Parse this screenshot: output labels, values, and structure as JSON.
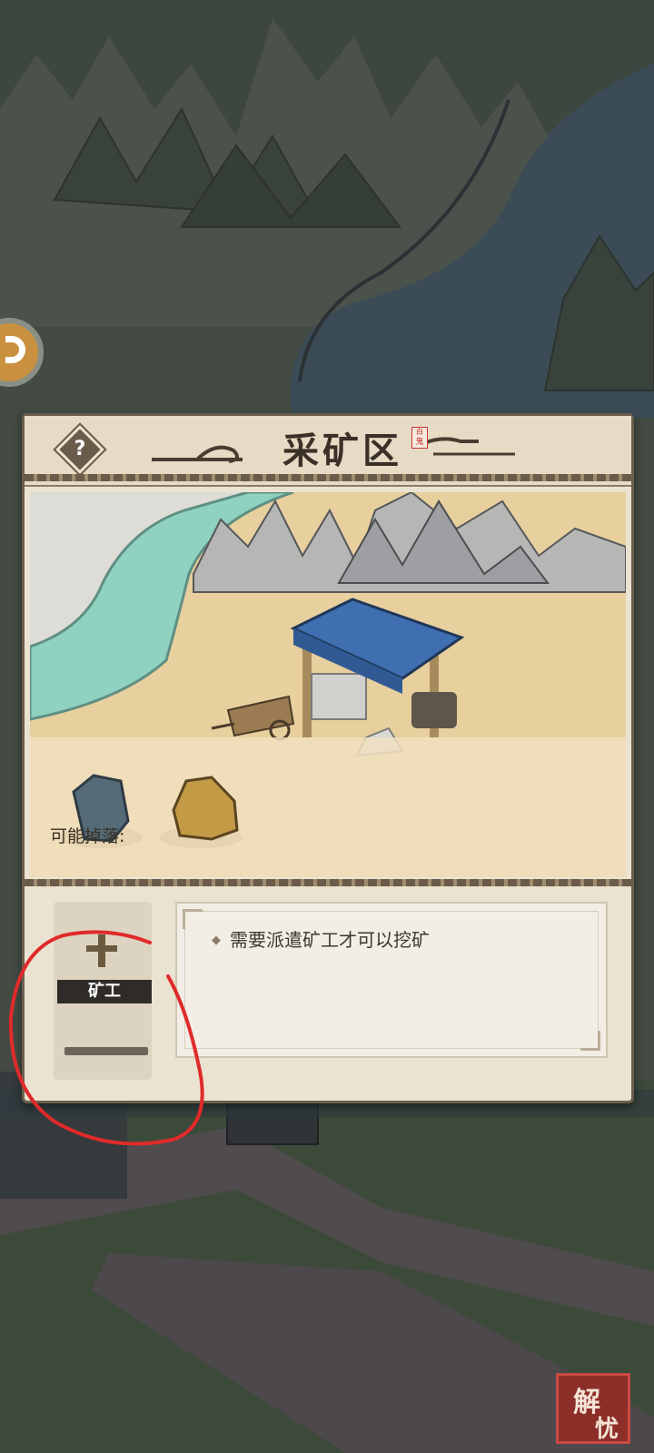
{
  "panel": {
    "title": "采矿区",
    "title_stamp": "百鬼",
    "help_label": "?",
    "drops_label": "可能掉落:",
    "drops": [
      {
        "name": "blue-ore-rock-icon",
        "color": "#556c78"
      },
      {
        "name": "gold-ore-rock-icon",
        "color": "#c39a45"
      }
    ],
    "worker_slot": {
      "label": "矿工",
      "add_icon": "plus-icon"
    },
    "description": "需要派遣矿工才可以挖矿"
  },
  "seal": {
    "text_top": "解",
    "text_bottom": "忧"
  },
  "colors": {
    "panel_bg": "#ebe3d1",
    "river": "#8fd2c0",
    "sand": "#e8cf9e",
    "tent_roof": "#3f6fb0",
    "annotation": "#e02a2a"
  }
}
